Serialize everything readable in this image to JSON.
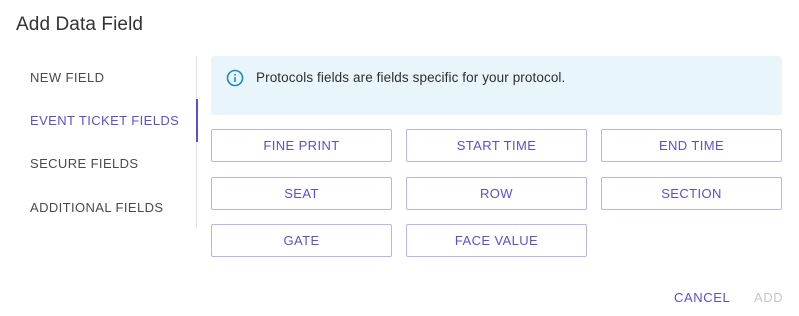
{
  "dialog": {
    "title": "Add Data Field"
  },
  "sidebar": {
    "items": [
      {
        "label": "NEW FIELD",
        "active": false
      },
      {
        "label": "EVENT TICKET FIELDS",
        "active": true
      },
      {
        "label": "SECURE FIELDS",
        "active": false
      },
      {
        "label": "ADDITIONAL FIELDS",
        "active": false
      }
    ]
  },
  "info": {
    "icon": "info-icon",
    "text": "Protocols fields are fields specific for your protocol."
  },
  "fields": [
    "FINE PRINT",
    "START TIME",
    "END TIME",
    "SEAT",
    "ROW",
    "SECTION",
    "GATE",
    "FACE VALUE"
  ],
  "footer": {
    "cancel_label": "CANCEL",
    "add_label": "ADD"
  },
  "colors": {
    "accent": "#5b4fd8",
    "info_bg": "#e8f6fc",
    "disabled": "#c7c7c7"
  }
}
